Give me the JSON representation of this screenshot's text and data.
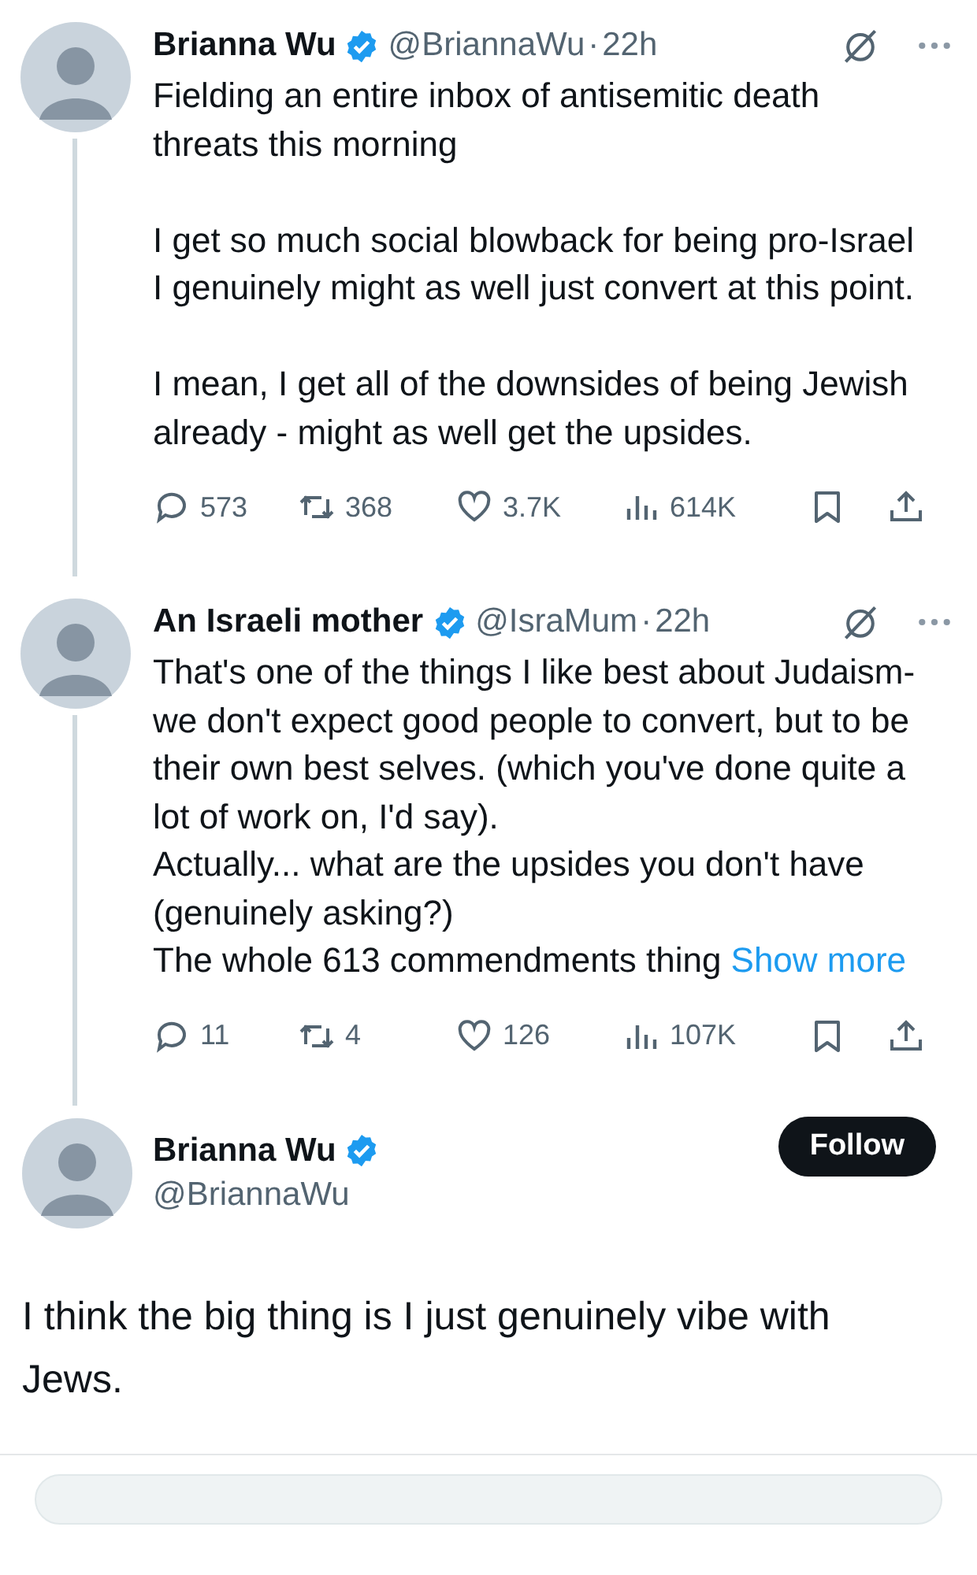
{
  "thread": [
    {
      "name": "Brianna Wu",
      "verified": true,
      "handle": "@BriannaWu",
      "separator": "·",
      "time": "22h",
      "paragraphs": [
        [
          "Fielding an entire inbox of antisemitic death threats this morning"
        ],
        [
          "I get so much social blowback for being pro-Israel I genuinely might as well just convert at this point."
        ],
        [
          "I mean, I get all of the downsides of being Jewish already - might as well get the upsides."
        ]
      ],
      "stats": [
        {
          "kind": "reply",
          "count": "573"
        },
        {
          "kind": "repost",
          "count": "368"
        },
        {
          "kind": "like",
          "count": "3.7K"
        },
        {
          "kind": "views",
          "count": "614K"
        },
        {
          "kind": "bookmark"
        },
        {
          "kind": "share"
        }
      ]
    },
    {
      "name": "An Israeli mother",
      "verified": true,
      "handle": "@IsraMum",
      "separator": "·",
      "time": "22h",
      "paragraphs": [
        [
          "That's one of the things I like best about Judaism- we don't expect good people to convert, but to be their own best selves. (which you've done quite a lot of work on, I'd say).",
          "Actually... what are the upsides you don't have (genuinely asking?)",
          "The whole 613 commendments thing"
        ]
      ],
      "show_more": "Show more",
      "stats": [
        {
          "kind": "reply",
          "count": "11"
        },
        {
          "kind": "repost",
          "count": "4"
        },
        {
          "kind": "like",
          "count": "126"
        },
        {
          "kind": "views",
          "count": "107K"
        },
        {
          "kind": "bookmark"
        },
        {
          "kind": "share"
        }
      ]
    }
  ],
  "main": {
    "name": "Brianna Wu",
    "verified": true,
    "handle": "@BriannaWu",
    "follow": "Follow",
    "text": "I think the big thing is I just genuinely vibe with Jews."
  }
}
